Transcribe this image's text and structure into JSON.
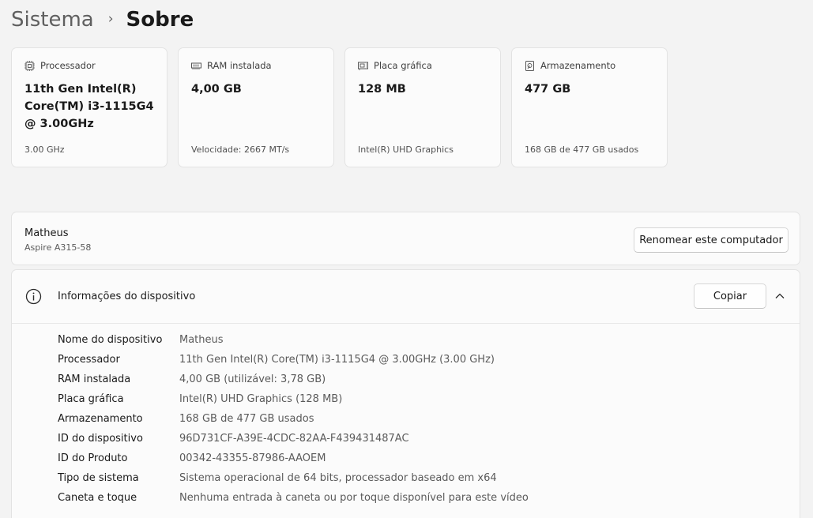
{
  "breadcrumb": {
    "parent": "Sistema",
    "separator": "›",
    "current": "Sobre"
  },
  "cards": [
    {
      "icon": "processor-icon",
      "label": "Processador",
      "value": "11th Gen Intel(R) Core(TM) i3-1115G4 @ 3.00GHz",
      "sub": "3.00 GHz"
    },
    {
      "icon": "ram-icon",
      "label": "RAM instalada",
      "value": "4,00 GB",
      "sub": "Velocidade: 2667 MT/s"
    },
    {
      "icon": "graphics-card-icon",
      "label": "Placa gráfica",
      "value": "128 MB",
      "sub": "Intel(R) UHD Graphics"
    },
    {
      "icon": "storage-icon",
      "label": "Armazenamento",
      "value": "477 GB",
      "sub": "168 GB de 477 GB usados"
    }
  ],
  "computer": {
    "name": "Matheus",
    "model": "Aspire A315-58",
    "rename_label": "Renomear este computador"
  },
  "device_info": {
    "title": "Informações do dispositivo",
    "copy_label": "Copiar",
    "rows": [
      {
        "key": "Nome do dispositivo",
        "value": "Matheus"
      },
      {
        "key": "Processador",
        "value": "11th Gen Intel(R) Core(TM) i3-1115G4 @ 3.00GHz (3.00 GHz)"
      },
      {
        "key": "RAM instalada",
        "value": "4,00 GB (utilizável: 3,78 GB)"
      },
      {
        "key": "Placa gráfica",
        "value": "Intel(R) UHD Graphics (128 MB)"
      },
      {
        "key": "Armazenamento",
        "value": "168 GB de 477 GB usados"
      },
      {
        "key": "ID do dispositivo",
        "value": "96D731CF-A39E-4CDC-82AA-F439431487AC"
      },
      {
        "key": "ID do Produto",
        "value": "00342-43355-87986-AAOEM"
      },
      {
        "key": "Tipo de sistema",
        "value": "Sistema operacional de 64 bits, processador baseado em x64"
      },
      {
        "key": "Caneta e toque",
        "value": "Nenhuma entrada à caneta ou por toque disponível para este vídeo"
      }
    ]
  }
}
